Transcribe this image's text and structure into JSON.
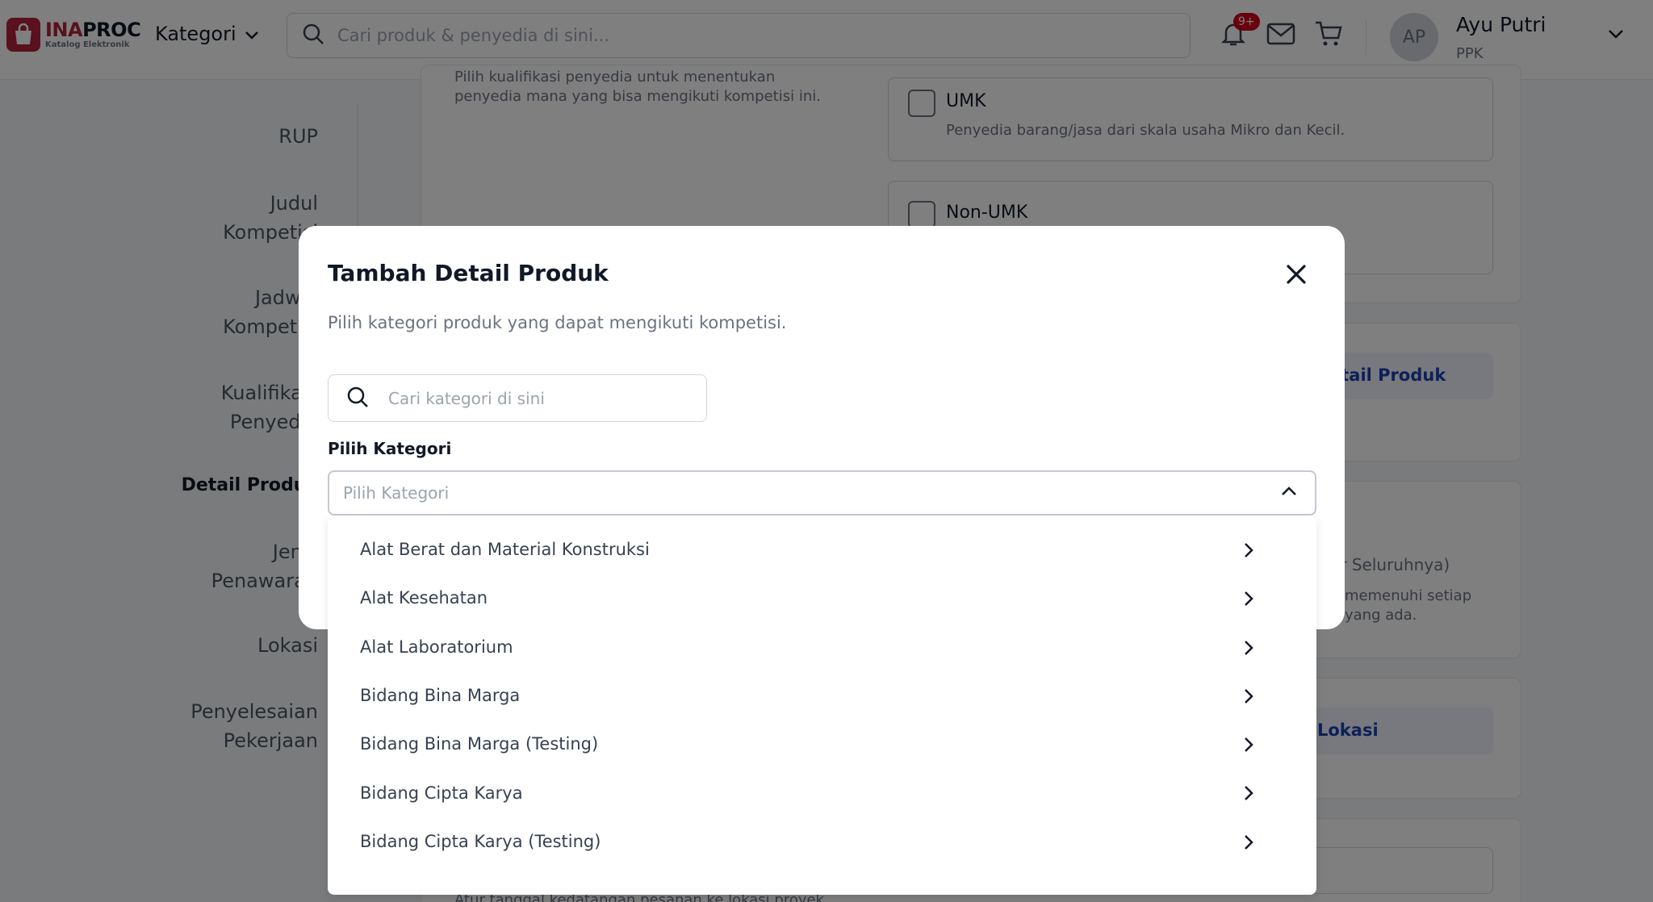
{
  "header": {
    "logo_main_red": "INA",
    "logo_main_dark": "PROC",
    "logo_sub": "Katalog Elektronik",
    "kategori_label": "Kategori",
    "search_placeholder": "Cari produk & penyedia di sini...",
    "notif_badge": "9+",
    "user_initials": "AP",
    "user_name": "Ayu Putri",
    "user_role": "PPK"
  },
  "sidebar": {
    "items": [
      {
        "label": "RUP"
      },
      {
        "label": "Judul Kompetisi"
      },
      {
        "label": "Jadwal Kompetisi"
      },
      {
        "label": "Kualifikasi Penyedia"
      },
      {
        "label": "Detail Produk"
      },
      {
        "label": "Jenis Penawaran"
      },
      {
        "label": "Lokasi"
      },
      {
        "label": "Penyelesaian Pekerjaan"
      }
    ]
  },
  "background": {
    "qualif_desc": "Pilih kualifikasi penyedia untuk menentukan penyedia mana yang bisa mengikuti kompetisi ini.",
    "umk_title": "UMK",
    "umk_desc": "Penyedia barang/jasa dari skala usaha Mikro dan Kecil.",
    "nonumk_title": "Non-UMK",
    "detail_btn": "etail Produk",
    "offer_title": "ar Seluruhnya)",
    "offer_desc1": "memenuhi setiap",
    "offer_desc2": "yang ada.",
    "lokasi_btn": "Lokasi",
    "bottom_text": "Atur tanggal kedatangan pesanan ke lokasi proyek"
  },
  "modal": {
    "title": "Tambah Detail Produk",
    "description": "Pilih kategori produk yang dapat mengikuti kompetisi.",
    "search_placeholder": "Cari kategori di sini",
    "select_label": "Pilih Kategori",
    "select_placeholder": "Pilih Kategori"
  },
  "dropdown": {
    "options": [
      {
        "label": "Alat Berat dan Material Konstruksi"
      },
      {
        "label": "Alat Kesehatan"
      },
      {
        "label": "Alat Laboratorium"
      },
      {
        "label": "Bidang Bina Marga"
      },
      {
        "label": "Bidang Bina Marga (Testing)"
      },
      {
        "label": "Bidang Cipta Karya"
      },
      {
        "label": "Bidang Cipta Karya (Testing)"
      }
    ]
  },
  "colors": {
    "brand": "#b0223a",
    "accent": "#1e40af",
    "badge": "#d0021b"
  }
}
